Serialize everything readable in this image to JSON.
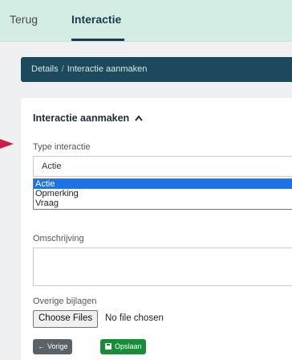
{
  "tabs": [
    {
      "label": "Terug"
    },
    {
      "label": "Interactie"
    }
  ],
  "breadcrumb": {
    "details": "Details",
    "separator": "/",
    "current": "Interactie aanmaken"
  },
  "form": {
    "section_title": "Interactie aanmaken",
    "section_caret": "^",
    "type_label": "Type interactie",
    "type_value": "Actie",
    "type_options": [
      "Actie",
      "Opmerking",
      "Vraag"
    ],
    "description_label": "Omschrijving",
    "attachments_label": "Overige bijlagen",
    "file_button": "Choose Files",
    "file_status": "No file chosen"
  },
  "buttons": {
    "back_label": "Vorige",
    "back_icon": "←",
    "save_label": "Opslaan"
  },
  "colors": {
    "topbar": "#d4ede4",
    "breadcrumb_bar": "#1c4a5c",
    "save_button": "#198c3a",
    "back_button": "#5a6268",
    "selected_option": "#1a73e8",
    "pointer_arrow": "#d01c4b"
  }
}
